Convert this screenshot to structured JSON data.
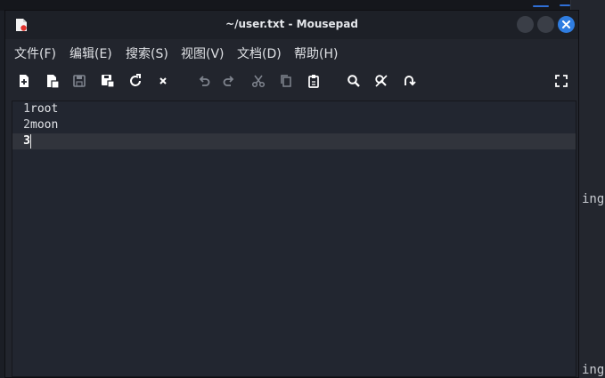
{
  "window": {
    "title": "~/user.txt - Mousepad",
    "app_icon": "mousepad-icon",
    "controls": [
      "minimize-icon",
      "maximize-icon",
      "close-icon"
    ],
    "accent": "#2f7de1"
  },
  "menubar": {
    "items": [
      {
        "label": "文件(F)"
      },
      {
        "label": "编辑(E)"
      },
      {
        "label": "搜索(S)"
      },
      {
        "label": "视图(V)"
      },
      {
        "label": "文档(D)"
      },
      {
        "label": "帮助(H)"
      }
    ]
  },
  "toolbar": {
    "buttons": [
      "new-file-icon",
      "new-window-icon",
      "save-icon",
      "save-as-icon",
      "reload-icon",
      "close-tab-icon",
      "undo-icon",
      "redo-icon",
      "cut-icon",
      "copy-icon",
      "paste-icon",
      "find-icon",
      "find-replace-icon",
      "go-to-line-icon",
      "fullscreen-icon"
    ]
  },
  "editor": {
    "lines": [
      {
        "number": "1",
        "text": "root"
      },
      {
        "number": "2",
        "text": "moon"
      },
      {
        "number": "3",
        "text": ""
      }
    ],
    "current_line": 3
  },
  "background": {
    "right_text_1": "ing,",
    "right_text_2": "ing,"
  }
}
